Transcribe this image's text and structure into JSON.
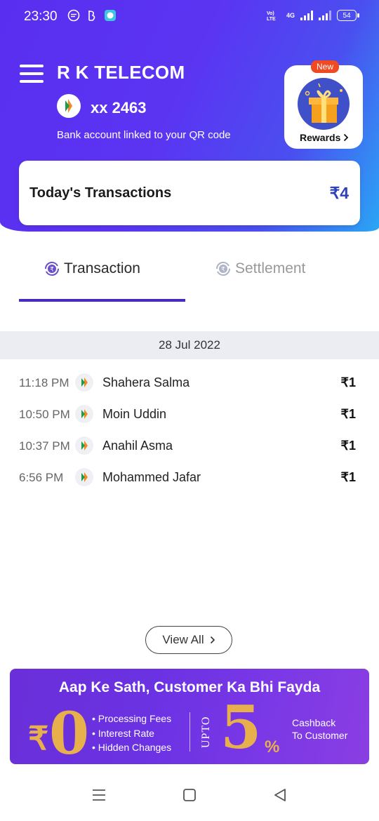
{
  "status_bar": {
    "time": "23:30",
    "network_label": "4G",
    "battery": "54"
  },
  "header": {
    "shop_name": "R K TELECOM",
    "account_masked": "xx 2463",
    "linked_note": "Bank account linked to your QR code"
  },
  "rewards": {
    "badge": "New",
    "label": "Rewards"
  },
  "summary": {
    "title": "Today's Transactions",
    "amount": "₹4"
  },
  "tabs": [
    {
      "label": "Transaction",
      "active": true
    },
    {
      "label": "Settlement",
      "active": false
    }
  ],
  "transactions": {
    "date": "28 Jul 2022",
    "rows": [
      {
        "time": "11:18 PM",
        "name": "Shahera Salma",
        "amount": "₹1"
      },
      {
        "time": "10:50 PM",
        "name": "Moin Uddin",
        "amount": "₹1"
      },
      {
        "time": "10:37 PM",
        "name": "Anahil Asma",
        "amount": "₹1"
      },
      {
        "time": "6:56 PM",
        "name": "Mohammed Jafar",
        "amount": "₹1"
      }
    ]
  },
  "view_all": {
    "label": "View All"
  },
  "banner": {
    "title": "Aap Ke Sath, Customer Ka Bhi Fayda",
    "rupee": "₹",
    "zero": "0",
    "bullets": [
      "Processing Fees",
      "Interest Rate",
      "Hidden Changes"
    ],
    "upto": "UPTO",
    "five": "5",
    "percent": "%",
    "cashback_line1": "Cashback",
    "cashback_line2": "To Customer"
  },
  "colors": {
    "hero_start": "#5a2ef0",
    "hero_end": "#2aa6f5",
    "accent": "#4b2bbf",
    "amount_blue": "#2f40b8",
    "gold": "#e8b04d"
  },
  "icons": {
    "menu": "hamburger-icon",
    "bank": "bhim-upi-icon",
    "gift": "gift-icon",
    "transaction_tab": "rupee-cycle-icon",
    "settlement_tab": "rupee-cycle-icon",
    "nav": [
      "recent-apps-icon",
      "home-icon",
      "back-icon"
    ]
  }
}
